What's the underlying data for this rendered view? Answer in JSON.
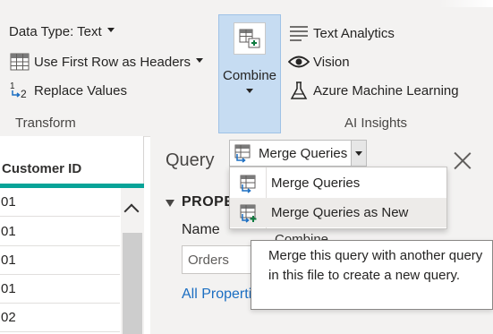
{
  "ribbon": {
    "transform": {
      "data_type_label": "Data Type: Text",
      "first_row_label": "Use First Row as Headers",
      "replace_values_label": "Replace Values",
      "group_label": "Transform"
    },
    "combine": {
      "label": "Combine"
    },
    "ai_insights": {
      "text_analytics_label": "Text Analytics",
      "vision_label": "Vision",
      "azure_ml_label": "Azure Machine Learning",
      "group_label": "AI Insights"
    }
  },
  "grid": {
    "column_header": "Customer ID",
    "rows": [
      "01",
      "01",
      "01",
      "01",
      "02"
    ]
  },
  "query_panel": {
    "title": "Query",
    "properties_heading": "PROPERTIES",
    "name_label": "Name",
    "name_value": "Orders",
    "all_properties_link": "All Properties",
    "combine_hint": "Combine"
  },
  "merge_dropdown": {
    "button_label": "Merge Queries",
    "items": [
      {
        "label": "Merge Queries"
      },
      {
        "label": "Merge Queries as New"
      }
    ]
  },
  "tooltip": {
    "text": "Merge this query with another query in this file to create a new query."
  },
  "colors": {
    "accent_teal": "#07a398",
    "combine_selected": "#c6dcf2",
    "link_blue": "#1b6ec2"
  },
  "icons": {
    "data_type": "none",
    "first_row": "table-header-icon",
    "replace_values": "replace-values-icon",
    "combine": "combine-icon",
    "text_analytics": "text-lines-icon",
    "vision": "eye-icon",
    "azure_ml": "flask-icon",
    "merge": "merge-queries-icon",
    "merge_new": "merge-queries-new-icon"
  }
}
